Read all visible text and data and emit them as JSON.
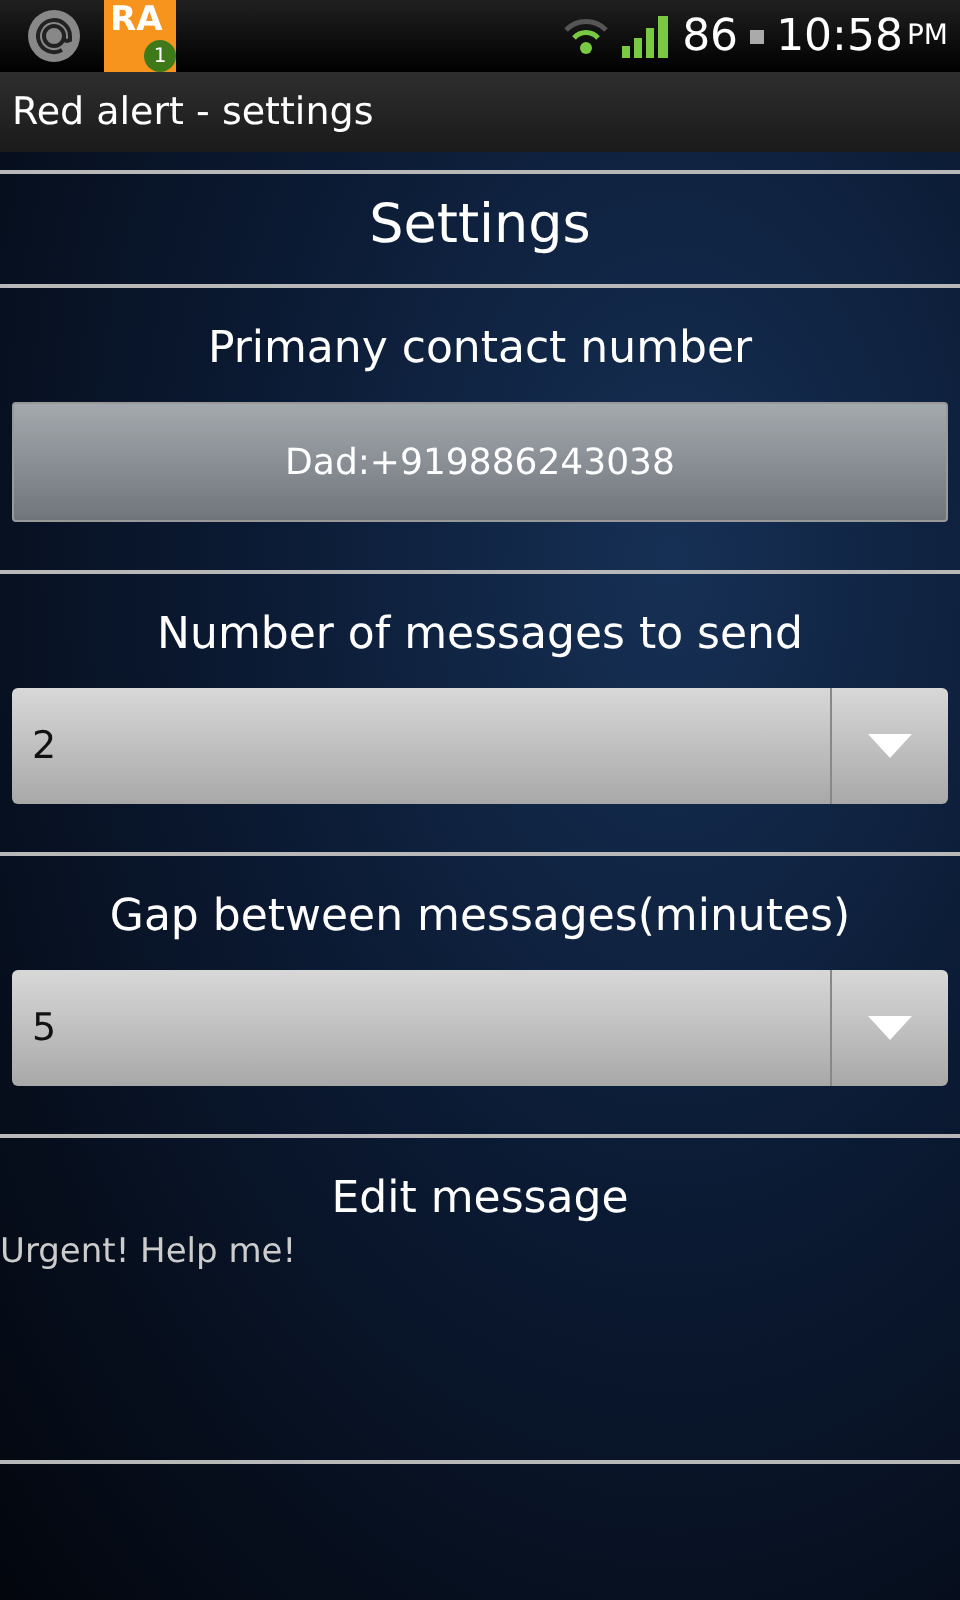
{
  "status_bar": {
    "app_icon_text": "RA",
    "notification_count": "1",
    "battery": "86",
    "time": "10:58",
    "am_pm": "PM"
  },
  "window": {
    "title": "Red alert - settings"
  },
  "heading": "Settings",
  "sections": [
    {
      "kind": "button",
      "label": "Primany contact number",
      "value": "Dad:+919886243038"
    },
    {
      "kind": "dropdown",
      "label": "Number of messages to send",
      "value": "2"
    },
    {
      "kind": "dropdown",
      "label": "Gap between messages(minutes)",
      "value": "5"
    },
    {
      "kind": "textarea",
      "label": "Edit message",
      "value": "Urgent! Help me!"
    }
  ]
}
